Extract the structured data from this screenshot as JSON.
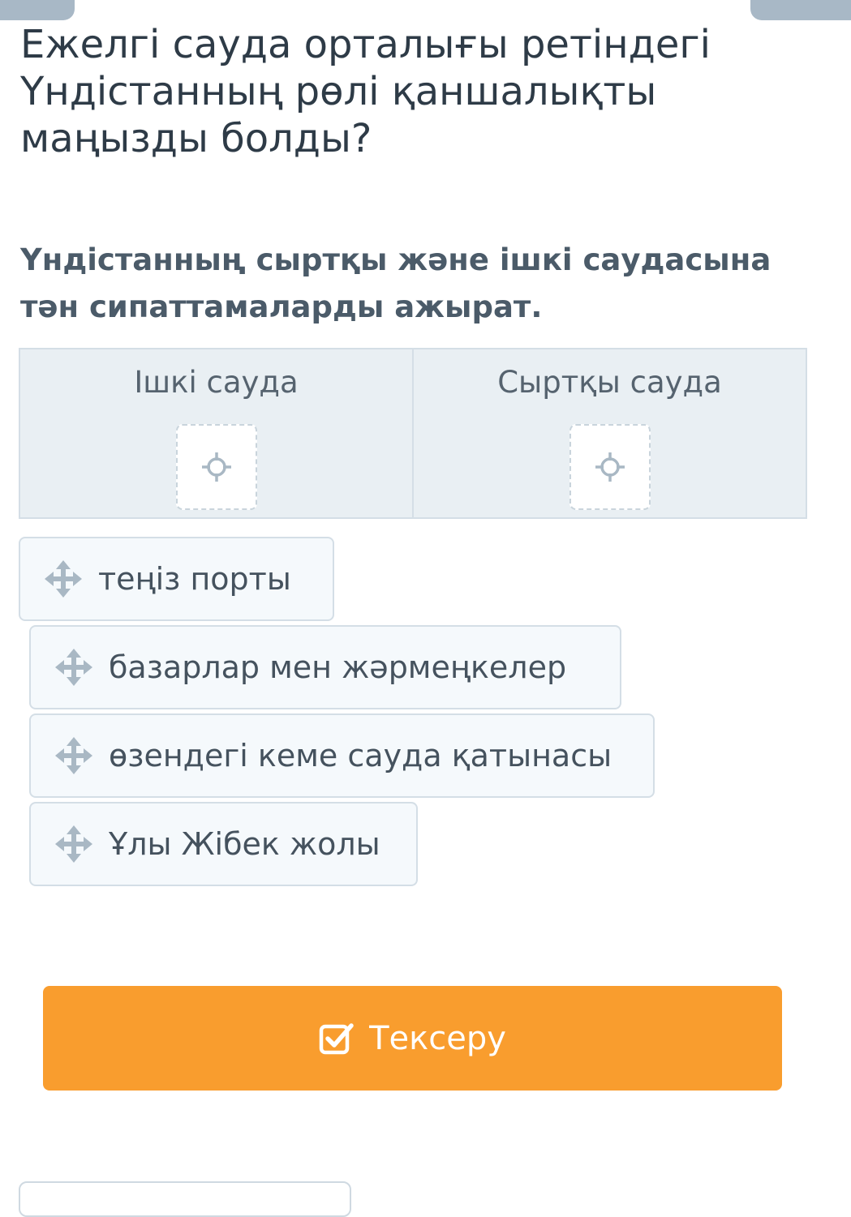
{
  "header": {
    "title": "Ежелгі сауда орталығы ретіндегі Үндістанның рөлі қаншалықты маңызды болды?"
  },
  "task": {
    "instruction": "Үндістанның сыртқы және ішкі саудасына тән сипаттамаларды ажырат."
  },
  "categories": [
    {
      "label": "Ішкі сауда",
      "icon": "target-icon"
    },
    {
      "label": "Сыртқы сауда",
      "icon": "target-icon"
    }
  ],
  "items": [
    {
      "label": "теңіз порты",
      "icon": "move-icon"
    },
    {
      "label": "базарлар мен жәрмеңкелер",
      "icon": "move-icon"
    },
    {
      "label": "өзендегі кеме сауда қатынасы",
      "icon": "move-icon"
    },
    {
      "label": "Ұлы Жібек жолы",
      "icon": "move-icon"
    }
  ],
  "actions": {
    "check_label": "Тексеру",
    "check_icon": "checkbox-check-icon"
  },
  "colors": {
    "accent": "#f99d2e",
    "table_bg": "#e9eff3",
    "border": "#d4dee6",
    "icon": "#a9b8c4"
  }
}
